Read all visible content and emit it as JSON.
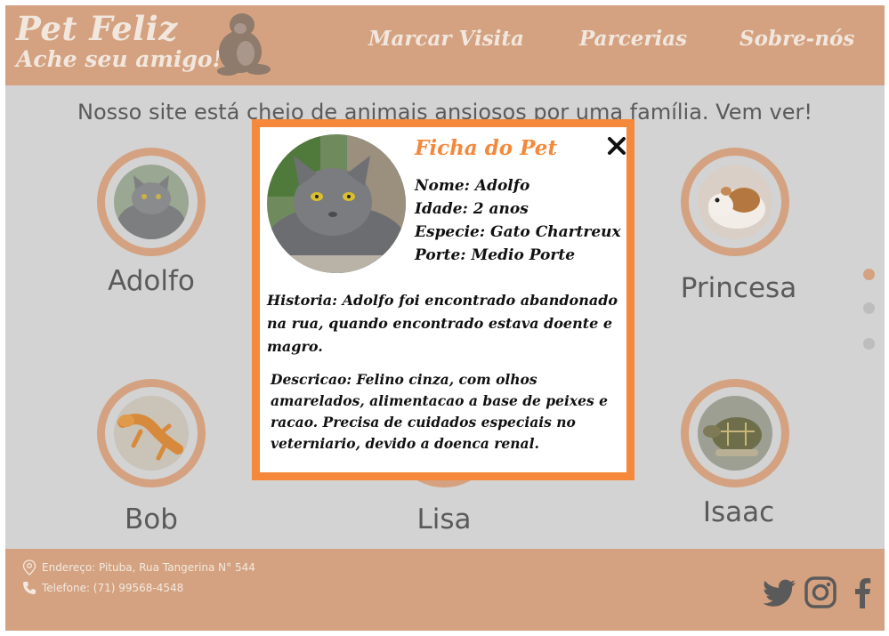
{
  "header": {
    "brand_title": "Pet Feliz",
    "brand_subtitle": "Ache seu amigo!",
    "logo_icon": "gorilla-icon",
    "nav": [
      {
        "label": "Marcar Visita"
      },
      {
        "label": "Parcerias"
      },
      {
        "label": "Sobre-nós"
      }
    ]
  },
  "main": {
    "tagline": "Nosso site está cheio de animais ansiosos por uma família. Vem ver!",
    "pets": [
      {
        "name": "Adolfo",
        "photo": "gray-cat"
      },
      {
        "name": "Princesa",
        "photo": "guinea-pig"
      },
      {
        "name": "Bob",
        "photo": "orange-lizard"
      },
      {
        "name": "Lisa",
        "photo": "hidden"
      },
      {
        "name": "Isaac",
        "photo": "turtle"
      }
    ],
    "carousel": {
      "active_index": 0,
      "count": 3
    }
  },
  "modal": {
    "title": "Ficha do Pet",
    "name": "Nome: Adolfo",
    "age": "Idade: 2 anos",
    "species": "Especie: Gato Chartreux",
    "size": "Porte: Medio Porte",
    "history": "Historia: Adolfo foi encontrado abandonado na rua, quando encontrado estava doente e magro.",
    "description": "Descricao: Felino cinza, com olhos amarelados, alimentacao a base de peixes e racao. Precisa de cuidados especiais no veterniario, devido a doenca renal."
  },
  "footer": {
    "address": "Endereço: Pituba, Rua Tangerina N° 544",
    "phone": "Telefone: (71) 99568-4548",
    "social": [
      "twitter-icon",
      "instagram-icon",
      "facebook-icon"
    ]
  },
  "colors": {
    "brand": "#d4a280",
    "accent": "#f5883a",
    "overlay_bg": "#d3d3d3",
    "header_text": "#f1e7de"
  }
}
